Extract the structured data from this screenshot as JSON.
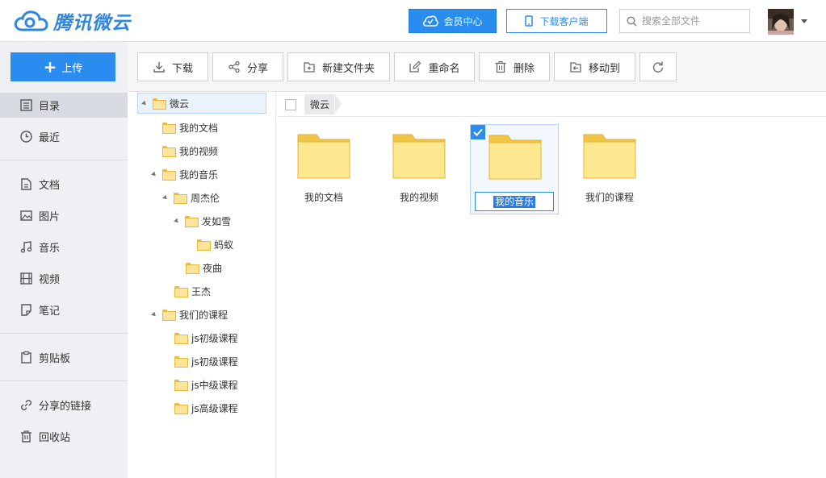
{
  "brand": {
    "logo_text": "腾讯微云",
    "accent": "#2b8cf0"
  },
  "header": {
    "vip_label": "会员中心",
    "client_label": "下载客户端",
    "search_placeholder": "搜索全部文件"
  },
  "sidebar": {
    "upload_label": "上传",
    "items": [
      {
        "label": "目录",
        "icon": "catalog-icon"
      },
      {
        "label": "最近",
        "icon": "clock-icon"
      },
      {
        "label": "文档",
        "icon": "document-icon"
      },
      {
        "label": "图片",
        "icon": "image-icon"
      },
      {
        "label": "音乐",
        "icon": "music-icon"
      },
      {
        "label": "视频",
        "icon": "video-icon"
      },
      {
        "label": "笔记",
        "icon": "note-icon"
      },
      {
        "label": "剪贴板",
        "icon": "clipboard-icon"
      },
      {
        "label": "分享的链接",
        "icon": "link-icon"
      },
      {
        "label": "回收站",
        "icon": "trash-icon"
      }
    ]
  },
  "toolbar": {
    "download": "下载",
    "share": "分享",
    "new_folder": "新建文件夹",
    "rename": "重命名",
    "delete": "删除",
    "move_to": "移动到"
  },
  "tree": [
    {
      "label": "微云",
      "depth": 0,
      "expanded": true
    },
    {
      "label": "我的文档",
      "depth": 1,
      "expanded": false
    },
    {
      "label": "我的视频",
      "depth": 1,
      "expanded": false
    },
    {
      "label": "我的音乐",
      "depth": 1,
      "expanded": true
    },
    {
      "label": "周杰伦",
      "depth": 2,
      "expanded": true
    },
    {
      "label": "发如雪",
      "depth": 3,
      "expanded": true
    },
    {
      "label": "蚂蚁",
      "depth": 4,
      "expanded": false
    },
    {
      "label": "夜曲",
      "depth": 3,
      "expanded": false
    },
    {
      "label": "王杰",
      "depth": 2,
      "expanded": false
    },
    {
      "label": "我们的课程",
      "depth": 1,
      "expanded": true
    },
    {
      "label": "js初级课程",
      "depth": 2,
      "expanded": false
    },
    {
      "label": "js初级课程",
      "depth": 2,
      "expanded": false
    },
    {
      "label": "js中级课程",
      "depth": 2,
      "expanded": false
    },
    {
      "label": "js高级课程",
      "depth": 2,
      "expanded": false
    }
  ],
  "breadcrumb": {
    "root": "微云"
  },
  "files": [
    {
      "name": "我的文档",
      "selected": false
    },
    {
      "name": "我的视频",
      "selected": false
    },
    {
      "name": "我的音乐",
      "selected": true,
      "renaming": true
    },
    {
      "name": "我们的课程",
      "selected": false
    }
  ]
}
